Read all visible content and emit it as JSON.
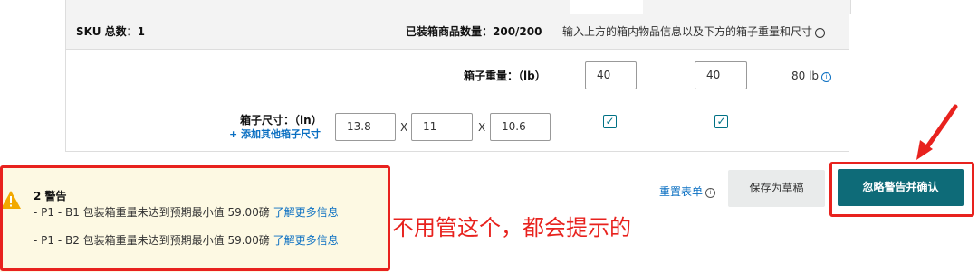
{
  "summary": {
    "sku_total": "SKU 总数：1",
    "packed_count": "已装箱商品数量：200/200",
    "hint": "输入上方的箱内物品信息以及下方的箱子重量和尺寸"
  },
  "box": {
    "weight_label": "箱子重量：（lb）",
    "weights": [
      "40",
      "40"
    ],
    "total_weight": "80 lb",
    "dims_label": "箱子尺寸：（in）",
    "add_dims_link": "+ 添加其他箱子尺寸",
    "dims": [
      "13.8",
      "11",
      "10.6"
    ],
    "dim_separator": "X",
    "check_mark": "✓"
  },
  "actions": {
    "reset_label": "重置表单",
    "save_draft_label": "保存为草稿",
    "confirm_label": "忽略警告并确认"
  },
  "warning": {
    "title": "2 警告",
    "lines": [
      {
        "text": "- P1 - B1 包装箱重量未达到预期最小值 59.00磅",
        "link": "了解更多信息"
      },
      {
        "text": "- P1 - B2 包装箱重量未达到预期最小值 59.00磅",
        "link": "了解更多信息"
      }
    ]
  },
  "annotation": {
    "text": "不用管这个，都会提示的",
    "color": "#e8221e"
  },
  "colors": {
    "accent": "#0e6b78",
    "link": "#0a6fc2",
    "warning_bg": "#fdf9e3",
    "warning_icon": "#f2a900",
    "highlight": "#e8221e"
  },
  "icons": {
    "info": "info-icon",
    "warning": "warning-triangle-icon",
    "arrow": "red-arrow-annotation"
  }
}
